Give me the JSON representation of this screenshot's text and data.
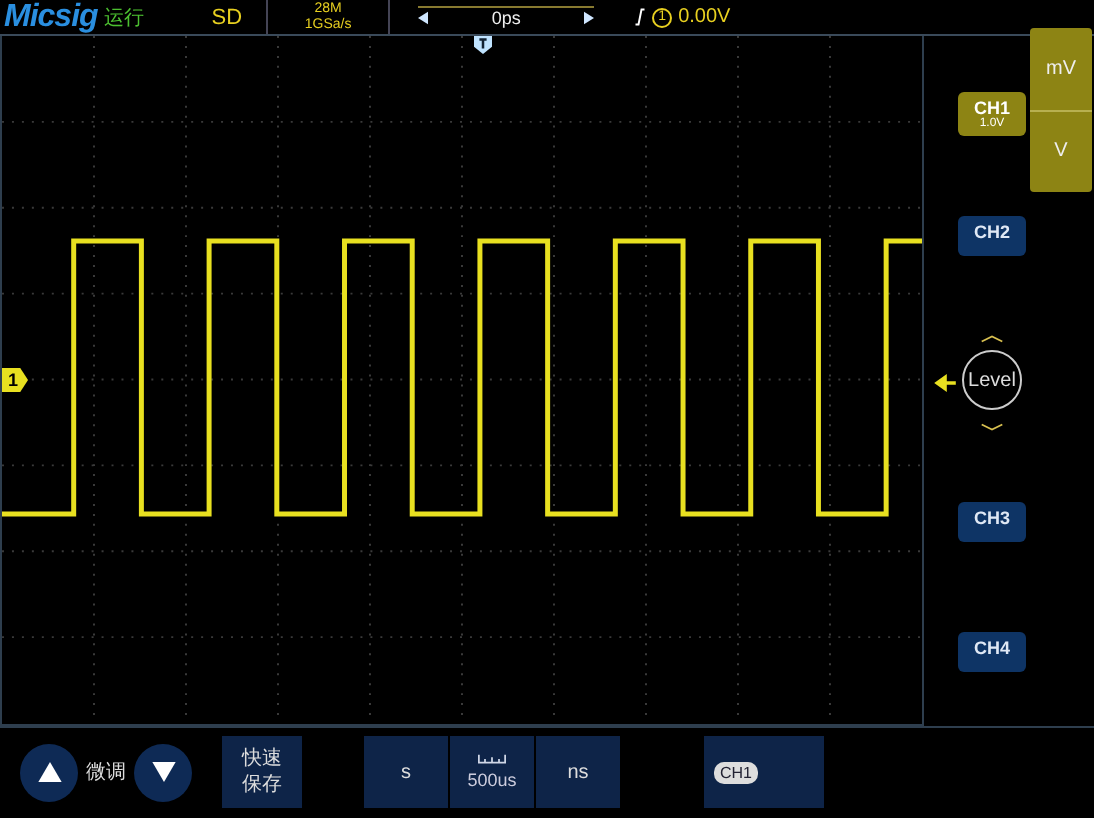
{
  "header": {
    "brand": "Micsig",
    "run_state": "运行",
    "mode": "SD",
    "memory_depth": "28M",
    "sample_rate": "1GSa/s",
    "time_offset": "0ps",
    "trigger_channel": "1",
    "trigger_level": "0.00V"
  },
  "channel_marker": "1",
  "channels": [
    {
      "label": "CH1",
      "scale": "1.0V",
      "selected": true
    },
    {
      "label": "CH2",
      "selected": false
    },
    {
      "label": "CH3",
      "selected": false
    },
    {
      "label": "CH4",
      "selected": false
    }
  ],
  "unit_menu": [
    "mV",
    "V"
  ],
  "level_button": "Level",
  "bottom": {
    "fine_label": "微调",
    "quick_save": "快速保存",
    "time_units": [
      "s",
      "ns"
    ],
    "timebase": "500us",
    "source": "CH1"
  }
}
